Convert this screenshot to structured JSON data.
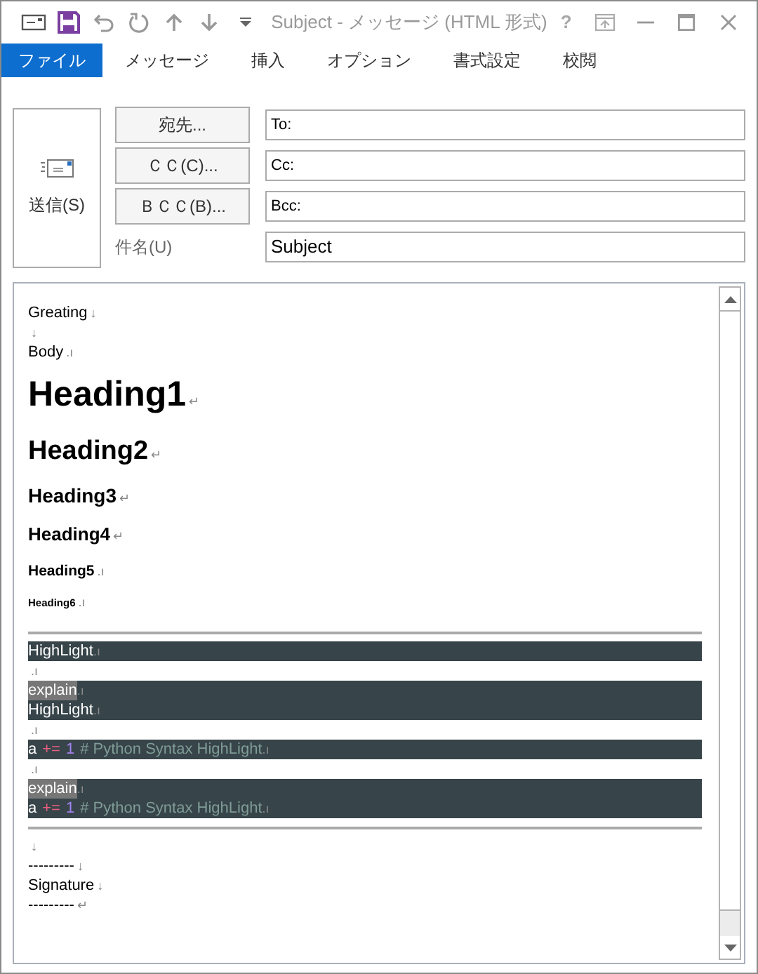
{
  "window": {
    "title": "Subject - メッセージ (HTML 形式)",
    "help": "?"
  },
  "tabs": [
    {
      "label": "ファイル",
      "selected": true
    },
    {
      "label": "メッセージ",
      "selected": false
    },
    {
      "label": "挿入",
      "selected": false
    },
    {
      "label": "オプション",
      "selected": false
    },
    {
      "label": "書式設定",
      "selected": false
    },
    {
      "label": "校閲",
      "selected": false
    }
  ],
  "send_button": "送信(S)",
  "address_rows": [
    {
      "button": "宛先...",
      "value": "To:"
    },
    {
      "button": "ＣＣ(C)...",
      "value": "Cc:"
    },
    {
      "button": "ＢＣＣ(B)...",
      "value": "Bcc:"
    }
  ],
  "subject": {
    "label": "件名(U)",
    "value": "Subject"
  },
  "body": [
    {
      "kind": "text",
      "text": "Greating",
      "mark": "↓"
    },
    {
      "kind": "text",
      "mark": "↓"
    },
    {
      "kind": "text",
      "text": "Body",
      "mark": ".ı"
    },
    {
      "kind": "h1",
      "text": "Heading1",
      "mark": "↵"
    },
    {
      "kind": "h2",
      "text": "Heading2",
      "mark": "↵"
    },
    {
      "kind": "h3",
      "text": "Heading3",
      "mark": "↵"
    },
    {
      "kind": "h4",
      "text": "Heading4",
      "mark": "↵"
    },
    {
      "kind": "h5",
      "text": "Heading5",
      "mark": ".ı"
    },
    {
      "kind": "h6",
      "text": "Heading6",
      "mark": ".ı"
    },
    {
      "kind": "rule"
    },
    {
      "kind": "code",
      "lines": [
        [
          {
            "kind": "plain",
            "text": "HighLight"
          },
          {
            "kind": "mark",
            "text": ".ı"
          }
        ]
      ]
    },
    {
      "kind": "text",
      "mark": ".ı"
    },
    {
      "kind": "code",
      "lines": [
        [
          {
            "kind": "explain",
            "text": "explain"
          },
          {
            "kind": "mark",
            "text": ".ı"
          }
        ],
        [
          {
            "kind": "plain",
            "text": "HighLight"
          },
          {
            "kind": "mark",
            "text": ".ı"
          }
        ]
      ]
    },
    {
      "kind": "text",
      "mark": ".ı"
    },
    {
      "kind": "code",
      "lines": [
        [
          {
            "kind": "plain",
            "text": "a"
          },
          {
            "kind": "operator",
            "text": "+="
          },
          {
            "kind": "number",
            "text": "1"
          },
          {
            "kind": "comment",
            "text": "# Python Syntax HighLight"
          },
          {
            "kind": "mark",
            "text": ".ı"
          }
        ]
      ]
    },
    {
      "kind": "text",
      "mark": ".ı"
    },
    {
      "kind": "code",
      "lines": [
        [
          {
            "kind": "explain",
            "text": "explain"
          },
          {
            "kind": "mark",
            "text": ".ı"
          }
        ],
        [
          {
            "kind": "plain",
            "text": "a"
          },
          {
            "kind": "operator",
            "text": "+="
          },
          {
            "kind": "number",
            "text": "1"
          },
          {
            "kind": "comment",
            "text": "# Python Syntax HighLight"
          },
          {
            "kind": "mark",
            "text": ".ı"
          }
        ]
      ]
    },
    {
      "kind": "rule"
    },
    {
      "kind": "text",
      "mark": "↓"
    },
    {
      "kind": "text",
      "text": "---------",
      "mark": "↓"
    },
    {
      "kind": "text",
      "text": "Signature",
      "mark": "↓"
    },
    {
      "kind": "text",
      "text": "---------",
      "mark": "↵"
    }
  ]
}
